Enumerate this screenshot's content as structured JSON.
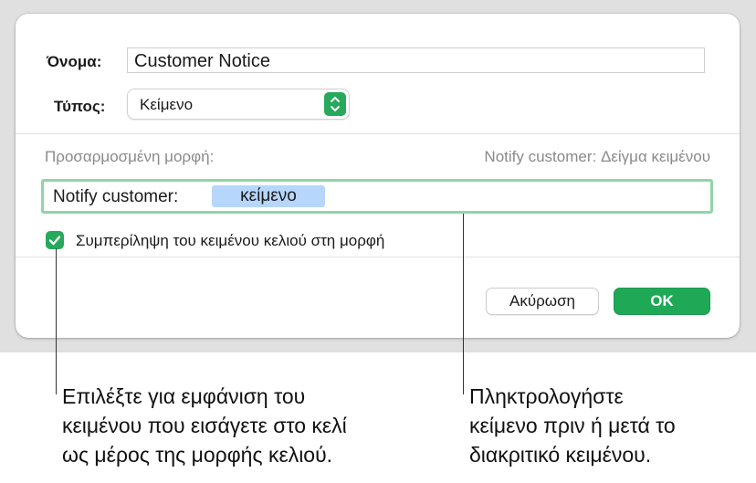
{
  "dialog": {
    "name_label": "Όνομα:",
    "name_value": "Customer Notice",
    "type_label": "Τύπος:",
    "type_value": "Κείμενο",
    "custom_format_label": "Προσαρμοσμένη μορφή:",
    "preview_text": "Notify customer: Δείγμα κειμένου",
    "format_prefix": "Notify customer:",
    "format_token": "κείμενο",
    "include_checkbox_label": "Συμπερίληψη του κειμένου κελιού στη μορφή",
    "include_checked": true,
    "cancel_label": "Ακύρωση",
    "ok_label": "OK"
  },
  "callouts": {
    "left": [
      "Επιλέξτε για εμφάνιση του",
      "κειμένου που εισάγετε στο κελί",
      "ως μέρος της μορφής κελιού."
    ],
    "right": [
      "Πληκτρολογήστε",
      "κείμενο πριν ή μετά το",
      "διακριτικό κειμένου."
    ]
  },
  "colors": {
    "accent": "#26a95a",
    "token_bg": "#b7d6fb",
    "field_focus": "#8fd6a6"
  }
}
